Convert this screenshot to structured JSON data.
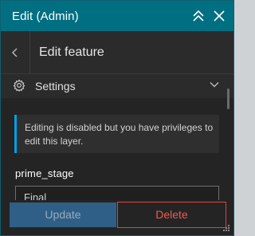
{
  "window": {
    "title": "Edit (Admin)",
    "collapse_icon": "double-chevron-up-icon",
    "close_icon": "close-icon"
  },
  "header": {
    "back_icon": "chevron-left-icon",
    "title": "Edit feature"
  },
  "settings": {
    "icon": "gear-icon",
    "label": "Settings",
    "expanded": false
  },
  "notice": {
    "text": "Editing is disabled but you have privileges to edit this layer."
  },
  "field": {
    "label": "prime_stage",
    "value": "Final"
  },
  "actions": {
    "update_label": "Update",
    "delete_label": "Delete"
  },
  "colors": {
    "titlebar": "#006f82",
    "info_accent": "#00a0e6",
    "update_button": "#2f5f86",
    "delete_accent": "#e0443c"
  }
}
